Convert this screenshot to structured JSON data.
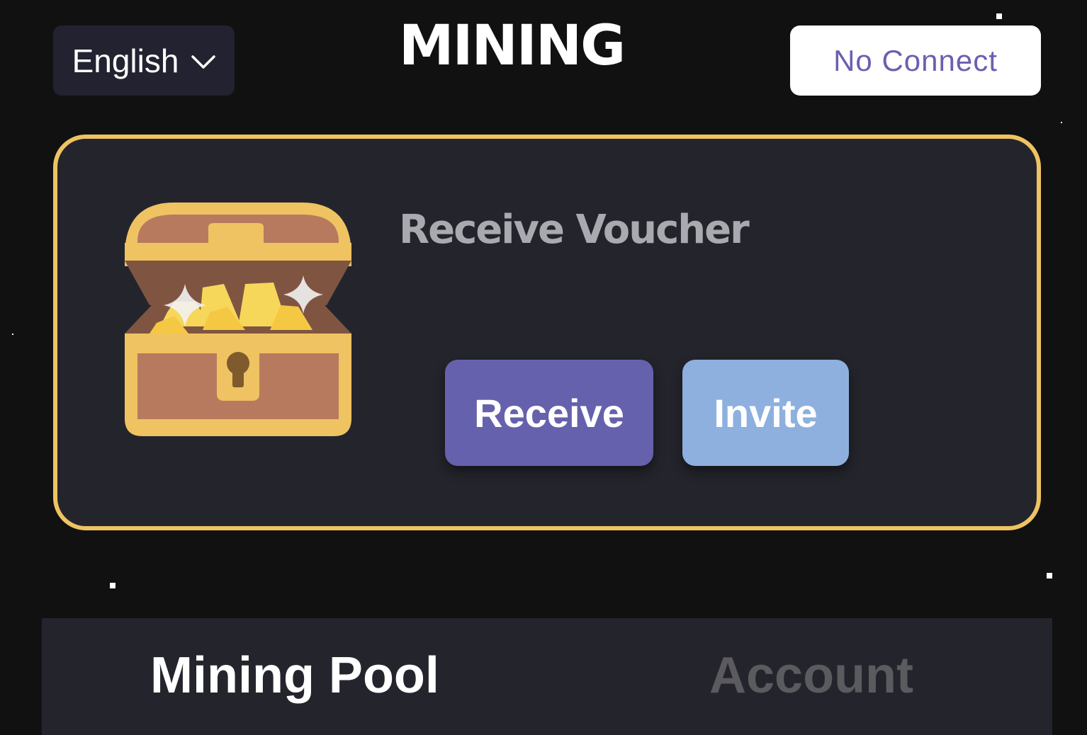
{
  "header": {
    "language": {
      "label": "English",
      "icon": "chevron-down-icon"
    },
    "brand_title": "MINING",
    "connect_button": "No Connect"
  },
  "voucher_card": {
    "icon": "treasure-chest-icon",
    "title": "Receive Voucher",
    "receive_button": "Receive",
    "invite_button": "Invite"
  },
  "tabs": [
    {
      "label": "Mining Pool",
      "active": true
    },
    {
      "label": "Account",
      "active": false
    }
  ],
  "colors": {
    "background": "#111112",
    "card": "#24252c",
    "card_border": "#efc362",
    "receive": "#6661ad",
    "invite": "#8db0de",
    "connect_text": "#6a60b0"
  }
}
